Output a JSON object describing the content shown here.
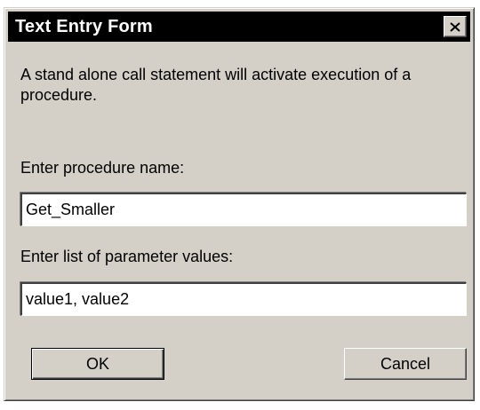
{
  "window": {
    "title": "Text Entry Form",
    "close_icon": "close-icon"
  },
  "form": {
    "description": "A stand alone call statement will activate execution of a procedure.",
    "procedure_label": "Enter procedure name:",
    "procedure_value": "Get_Smaller",
    "params_label": "Enter list of parameter values:",
    "params_value": "value1, value2"
  },
  "buttons": {
    "ok_label": "OK",
    "cancel_label": "Cancel"
  },
  "colors": {
    "titlebar": "#000000",
    "title_text": "#ffffff",
    "dialog_bg": "#d4d0c8",
    "field_bg": "#ffffff"
  }
}
